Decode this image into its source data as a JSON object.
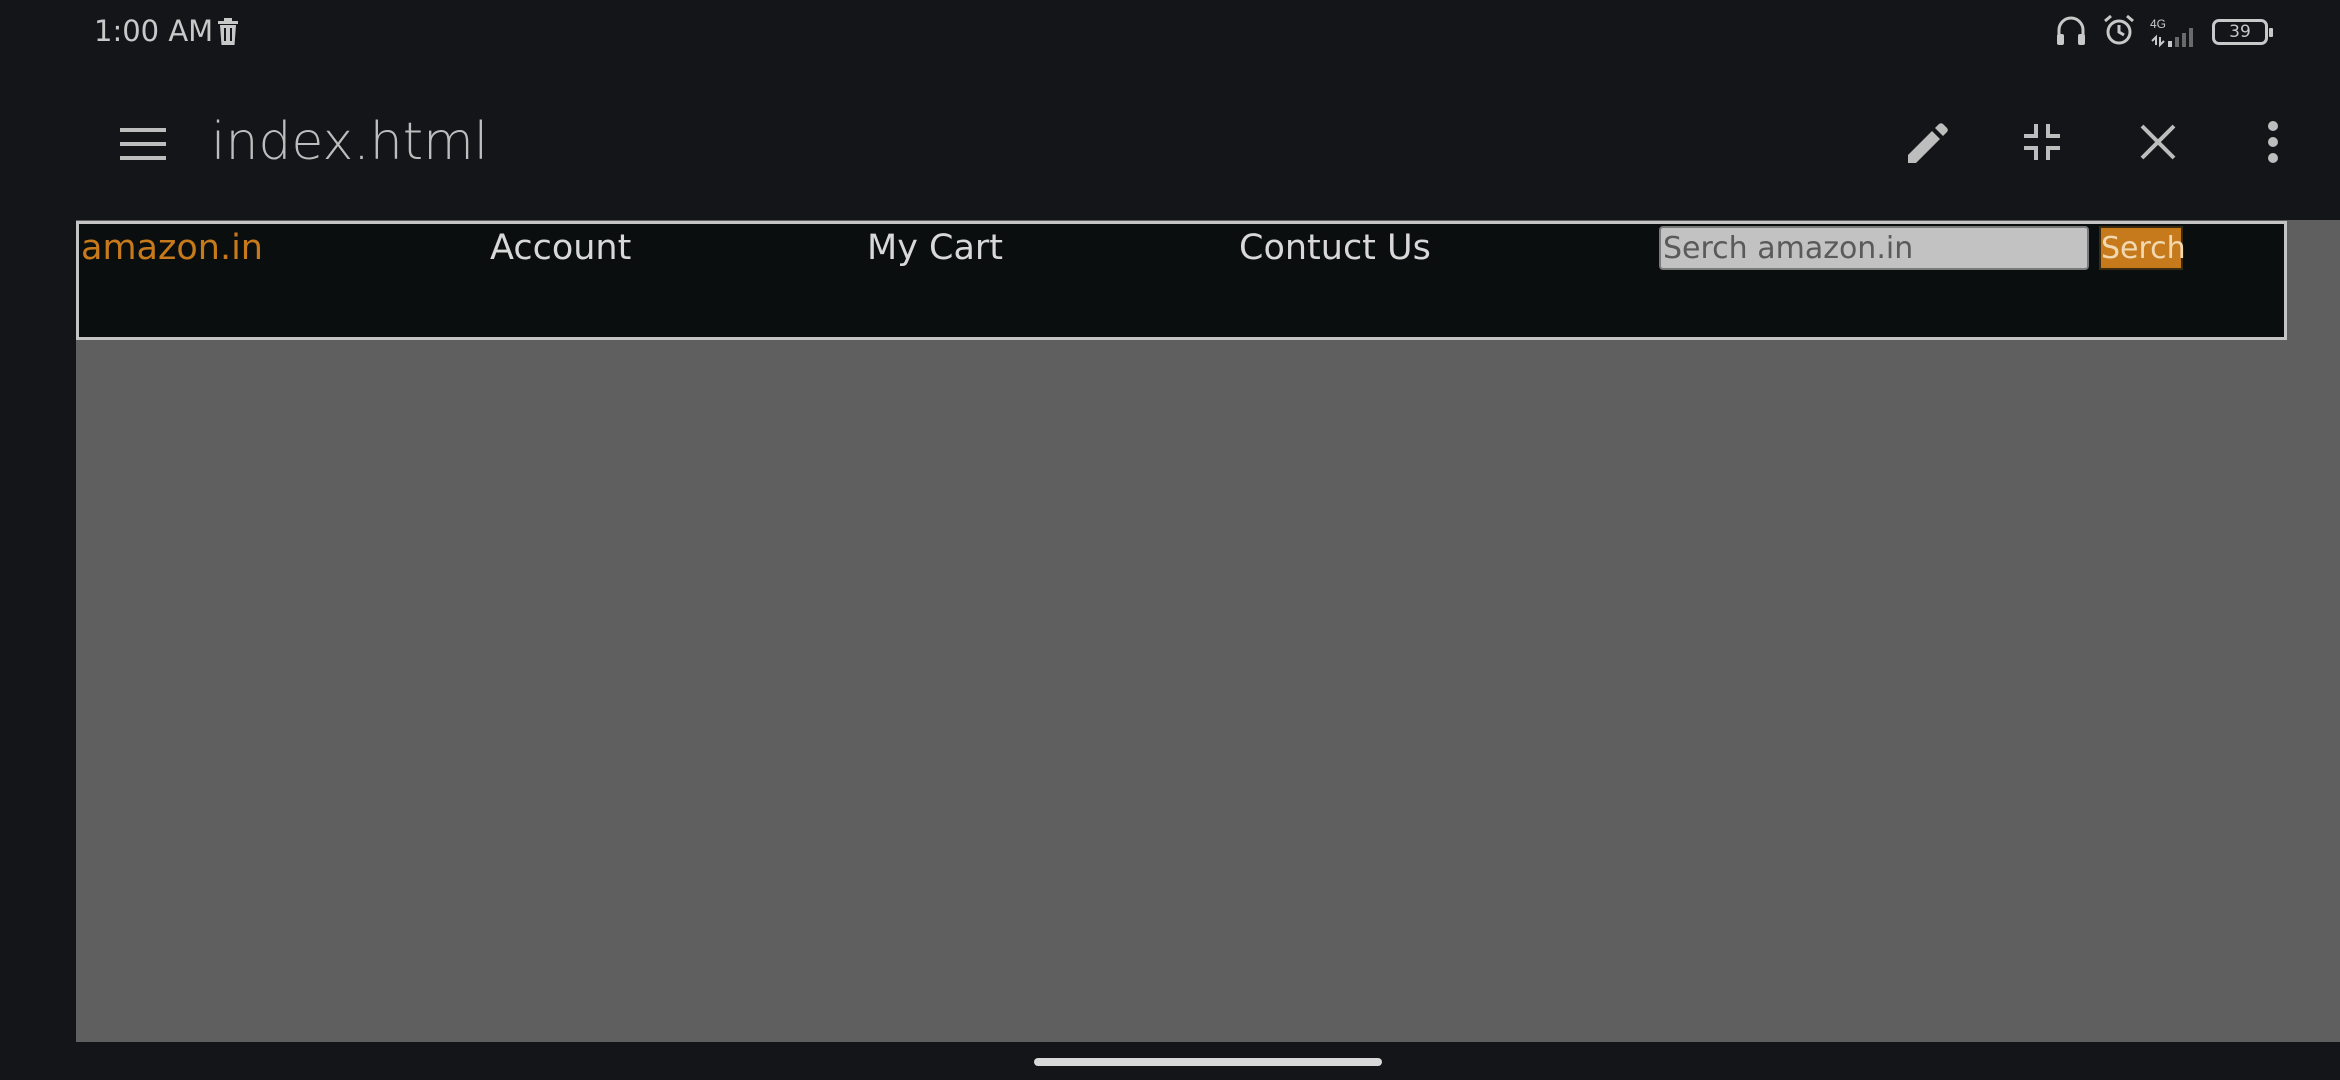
{
  "status_bar": {
    "time": "1:00 AM",
    "network": "4G",
    "battery": "39",
    "icons": [
      "trash-icon",
      "headphones-icon",
      "alarm-icon",
      "signal-icon",
      "battery-icon"
    ]
  },
  "app_bar": {
    "title": "index.html",
    "icons": [
      "menu-icon",
      "edit-icon",
      "collapse-icon",
      "close-icon",
      "more-vert-icon"
    ]
  },
  "page": {
    "logo": "amazon.in",
    "nav": {
      "account": "Account",
      "cart": "My Cart",
      "contact": "Contuct Us"
    },
    "search": {
      "placeholder": "Serch amazon.in",
      "button": "Serch"
    }
  },
  "colors": {
    "brand": "#c77a1b",
    "background": "#141518",
    "content": "#5f5f5f",
    "nav_bg": "#0b0e0e"
  }
}
